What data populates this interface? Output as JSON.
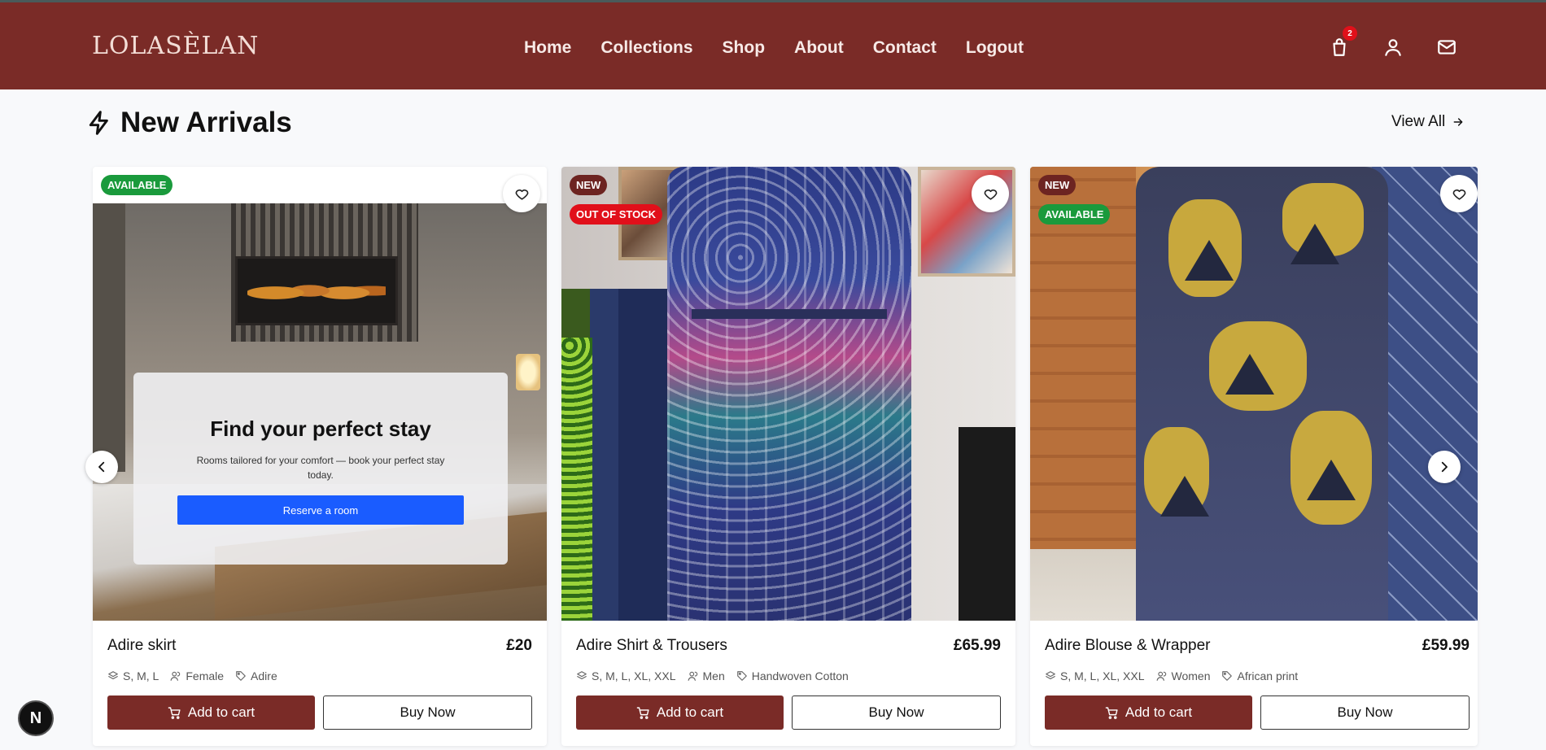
{
  "header": {
    "logo": "LOLASÈLAN",
    "nav": [
      "Home",
      "Collections",
      "Shop",
      "About",
      "Contact",
      "Logout"
    ],
    "cart_count": "2",
    "icons": [
      "shopping-bag-icon",
      "user-icon",
      "mail-icon"
    ]
  },
  "section": {
    "title": "New Arrivals",
    "view_all": "View All"
  },
  "promo": {
    "title": "Find your perfect stay",
    "text": "Rooms tailored for your comfort — book your perfect stay today.",
    "button": "Reserve a room"
  },
  "products": [
    {
      "badges": [
        "AVAILABLE"
      ],
      "name": "Adire skirt",
      "price": "£20",
      "sizes": "S, M, L",
      "gender": "Female",
      "material": "Adire",
      "add_to_cart": "Add to cart",
      "buy_now": "Buy Now"
    },
    {
      "badges": [
        "NEW",
        "OUT OF STOCK"
      ],
      "name": "Adire Shirt & Trousers",
      "price": "£65.99",
      "sizes": "S, M, L, XL, XXL",
      "gender": "Men",
      "material": "Handwoven Cotton",
      "add_to_cart": "Add to cart",
      "buy_now": "Buy Now"
    },
    {
      "badges": [
        "NEW",
        "AVAILABLE"
      ],
      "name": "Adire Blouse & Wrapper",
      "price": "£59.99",
      "sizes": "S, M, L, XL, XXL",
      "gender": "Women",
      "material": "African print",
      "add_to_cart": "Add to cart",
      "buy_now": "Buy Now"
    }
  ],
  "dev_badge": "N",
  "colors": {
    "header": "#7a2b27",
    "badge_available": "#1a9a3c",
    "badge_new": "#6d2421",
    "badge_out_of_stock": "#e10f1a",
    "reserve_button": "#1a5cff"
  }
}
